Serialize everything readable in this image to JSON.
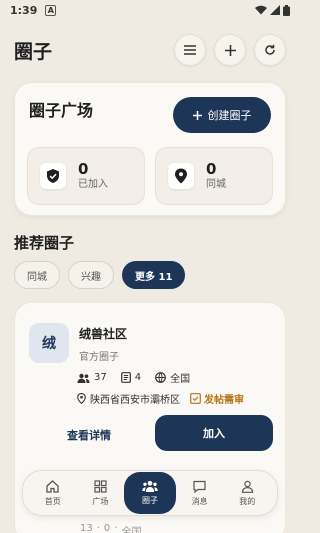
{
  "status_bar": {
    "time": "1:39",
    "badge": "A"
  },
  "header": {
    "title": "圈子"
  },
  "plaza": {
    "title": "圈子广场",
    "create_label": "创建圈子",
    "joined": {
      "count": "0",
      "label": "已加入"
    },
    "city": {
      "count": "0",
      "label": "同城"
    }
  },
  "recommend": {
    "title": "推荐圈子",
    "chips": [
      "同城",
      "兴趣",
      "更多 11"
    ]
  },
  "group": {
    "avatar_char": "绒",
    "name": "绒兽社区",
    "type": "官方圈子",
    "members": "37",
    "posts": "4",
    "scope": "全国",
    "location": "陕西省西安市灞桥区",
    "review": "发帖需审",
    "detail_label": "查看详情",
    "join_label": "加入"
  },
  "next_group": {
    "members": "13",
    "posts": "0",
    "scope": "全国"
  },
  "tabs": [
    {
      "label": "首页",
      "icon": "home-icon"
    },
    {
      "label": "广场",
      "icon": "grid-icon"
    },
    {
      "label": "圈子",
      "icon": "group-icon",
      "active": true
    },
    {
      "label": "消息",
      "icon": "message-icon"
    },
    {
      "label": "我的",
      "icon": "user-icon"
    }
  ],
  "colors": {
    "primary": "#1d3557",
    "background": "#efebe3",
    "warning": "#b8741a"
  }
}
